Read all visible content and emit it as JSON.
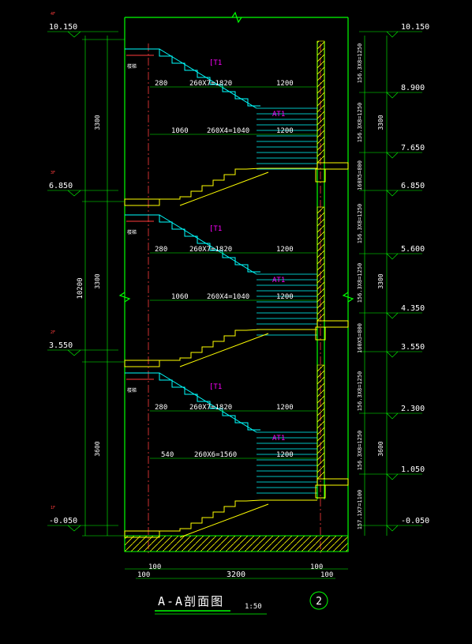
{
  "colors": {
    "background": "#000000",
    "wall": "#00ff00",
    "stair": "#ffff00",
    "tread": "#00ffff",
    "axis": "#ff3b3b",
    "text": "#ffffff",
    "label_tag": "#ff00ff",
    "hatch": "#ffff00"
  },
  "left_elevations": [
    {
      "floor": "4F",
      "value": "10.150"
    },
    {
      "floor": "3F",
      "value": "6.850"
    },
    {
      "floor": "2F",
      "value": "3.550"
    },
    {
      "floor": "1F",
      "value": "-0.050"
    }
  ],
  "right_elevations": [
    "10.150",
    "8.900",
    "7.650",
    "6.850",
    "5.600",
    "4.350",
    "3.550",
    "2.300",
    "1.050",
    "-0.050"
  ],
  "left_dims": {
    "floors": [
      "3300",
      "3300",
      "3600"
    ],
    "total": "10200"
  },
  "right_segments": [
    "156.3X8=1250",
    "156.3X8=1250",
    "160X5=800",
    "156.3X8=1250",
    "156.3X8=1250",
    "160X5=800",
    "156.3X8=1250",
    "156.3X8=1250",
    "157.1X7=1100"
  ],
  "right_floor_dims": [
    "3300",
    "3300",
    "3600"
  ],
  "flights": {
    "upper_tag": "[T1",
    "lower_tag": "AT1",
    "upper_dims": [
      {
        "a": "280",
        "b": "260X7=1820",
        "c": "1200"
      },
      {
        "a": "280",
        "b": "260X7=1820",
        "c": "1200"
      },
      {
        "a": "280",
        "b": "260X7=1820",
        "c": "1200"
      }
    ],
    "lower_dims": [
      {
        "a": "1060",
        "b": "260X4=1040",
        "c": "1200"
      },
      {
        "a": "1060",
        "b": "260X4=1040",
        "c": "1200"
      },
      {
        "a": "540",
        "b": "260X6=1560",
        "c": "1200"
      }
    ]
  },
  "small_note": "楼梯",
  "bottom_dims": [
    "100",
    "3200",
    "100",
    "100",
    "100"
  ],
  "title": "A-A剖面图",
  "scale": "1:50",
  "axis_bubble": "2"
}
